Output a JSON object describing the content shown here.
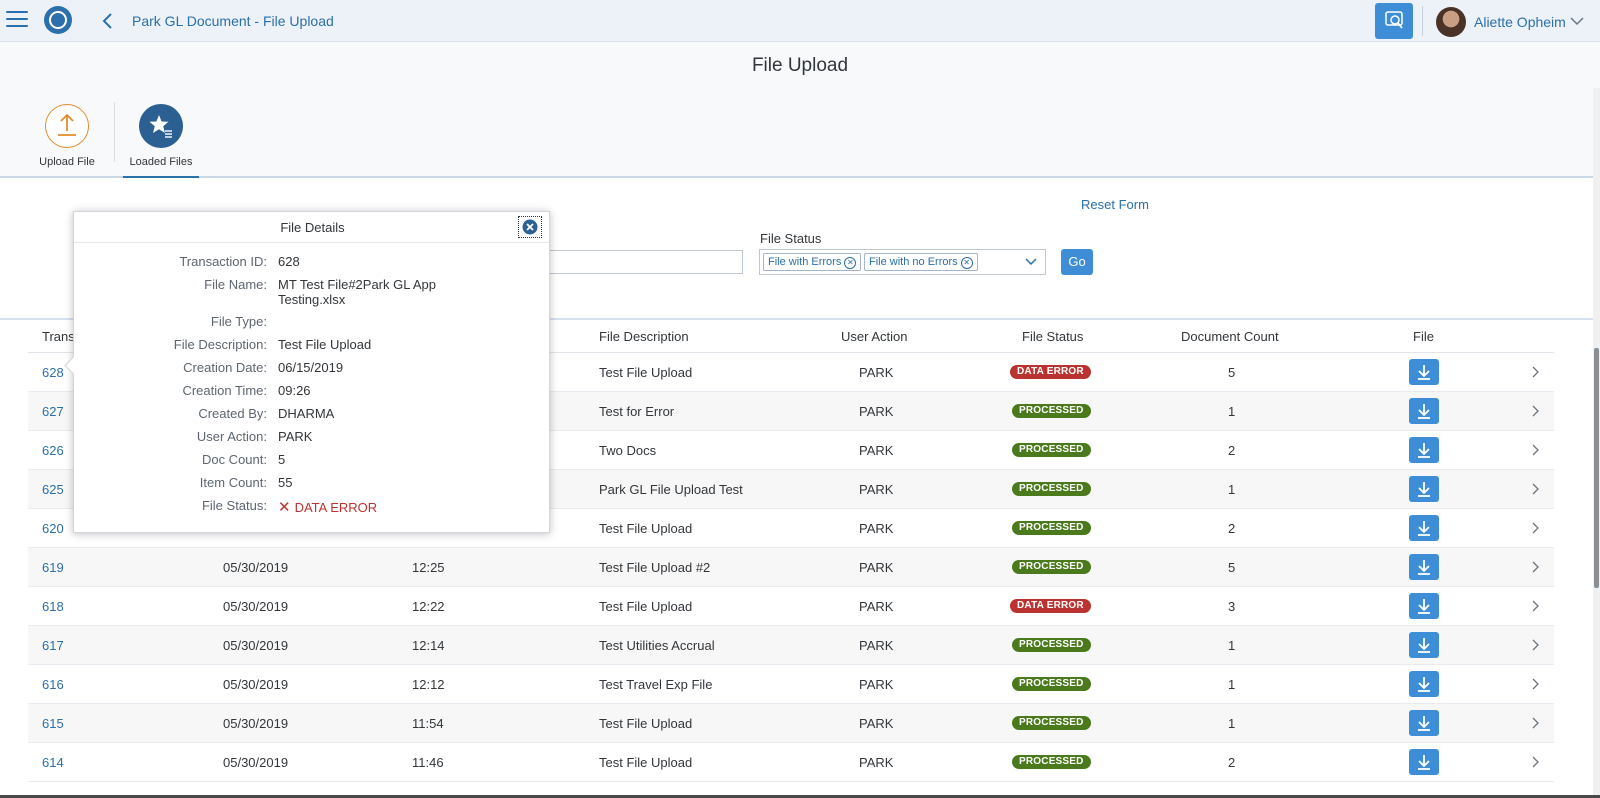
{
  "header": {
    "app_title": "Park GL Document - File Upload",
    "user_name": "Aliette Opheim"
  },
  "page": {
    "title": "File Upload"
  },
  "tabs": [
    {
      "label": "Upload File",
      "icon": "upload-icon",
      "color": "#e28c2d"
    },
    {
      "label": "Loaded Files",
      "icon": "star-list-icon",
      "color": "#2c5f92",
      "selected": true
    }
  ],
  "filters": {
    "reset_label": "Reset Form",
    "file_status_label": "File Status",
    "tokens": [
      "File with Errors",
      "File with no Errors"
    ],
    "go_label": "Go",
    "text_value": ""
  },
  "table": {
    "headers": [
      "Trans",
      "File Description",
      "User Action",
      "File Status",
      "Document Count",
      "File"
    ],
    "rows": [
      {
        "id": "628",
        "date": "",
        "time": "",
        "desc": "Test File Upload",
        "action": "PARK",
        "status": "DATA ERROR",
        "count": "5"
      },
      {
        "id": "627",
        "date": "",
        "time": "",
        "desc": "Test for Error",
        "action": "PARK",
        "status": "PROCESSED",
        "count": "1"
      },
      {
        "id": "626",
        "date": "",
        "time": "",
        "desc": "Two Docs",
        "action": "PARK",
        "status": "PROCESSED",
        "count": "2"
      },
      {
        "id": "625",
        "date": "",
        "time": "",
        "desc": "Park GL File Upload Test",
        "action": "PARK",
        "status": "PROCESSED",
        "count": "1"
      },
      {
        "id": "620",
        "date": "",
        "time": "",
        "desc": "Test File Upload",
        "action": "PARK",
        "status": "PROCESSED",
        "count": "2"
      },
      {
        "id": "619",
        "date": "05/30/2019",
        "time": "12:25",
        "desc": "Test File Upload #2",
        "action": "PARK",
        "status": "PROCESSED",
        "count": "5"
      },
      {
        "id": "618",
        "date": "05/30/2019",
        "time": "12:22",
        "desc": "Test File Upload",
        "action": "PARK",
        "status": "DATA ERROR",
        "count": "3"
      },
      {
        "id": "617",
        "date": "05/30/2019",
        "time": "12:14",
        "desc": "Test Utilities Accrual",
        "action": "PARK",
        "status": "PROCESSED",
        "count": "1"
      },
      {
        "id": "616",
        "date": "05/30/2019",
        "time": "12:12",
        "desc": "Test Travel Exp File",
        "action": "PARK",
        "status": "PROCESSED",
        "count": "1"
      },
      {
        "id": "615",
        "date": "05/30/2019",
        "time": "11:54",
        "desc": "Test File Upload",
        "action": "PARK",
        "status": "PROCESSED",
        "count": "1"
      },
      {
        "id": "614",
        "date": "05/30/2019",
        "time": "11:46",
        "desc": "Test File Upload",
        "action": "PARK",
        "status": "PROCESSED",
        "count": "2"
      }
    ]
  },
  "popover": {
    "title": "File Details",
    "fields": [
      {
        "label": "Transaction ID:",
        "value": "628"
      },
      {
        "label": "File Name:",
        "value": "MT Test File#2Park GL App Testing.xlsx"
      },
      {
        "label": "File Type:",
        "value": ""
      },
      {
        "label": "File Description:",
        "value": "Test File Upload"
      },
      {
        "label": "Creation Date:",
        "value": "06/15/2019"
      },
      {
        "label": "Creation Time:",
        "value": "09:26"
      },
      {
        "label": "Created By:",
        "value": "DHARMA"
      },
      {
        "label": "User Action:",
        "value": "PARK"
      },
      {
        "label": "Doc Count:",
        "value": "5"
      },
      {
        "label": "Item Count:",
        "value": "55"
      },
      {
        "label": "File Status:",
        "value": "DATA ERROR"
      }
    ]
  },
  "colors": {
    "accent": "#2b6fab",
    "button": "#3d8ed6",
    "error": "#bb3330",
    "success": "#4b7a1d"
  }
}
